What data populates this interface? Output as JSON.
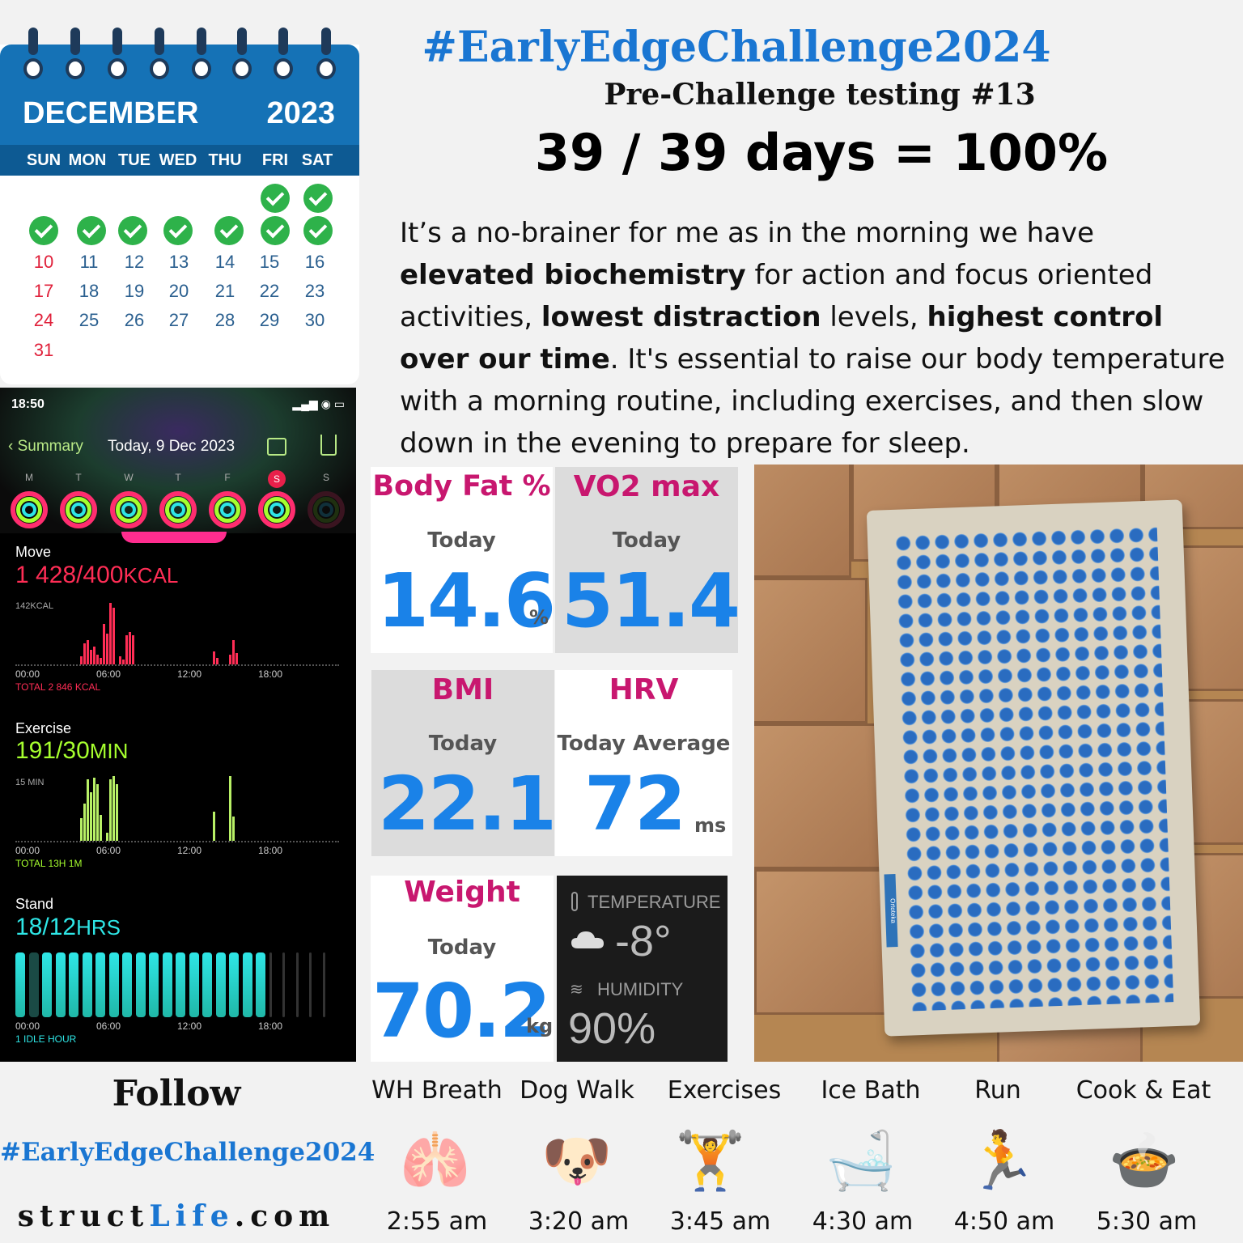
{
  "calendar": {
    "month": "DECEMBER",
    "year": "2023",
    "weekdays": [
      "SUN",
      "MON",
      "TUE",
      "WED",
      "THU",
      "FRI",
      "SAT"
    ],
    "rows": [
      [
        "10",
        "11",
        "12",
        "13",
        "14",
        "15",
        "16"
      ],
      [
        "17",
        "18",
        "19",
        "20",
        "21",
        "22",
        "23"
      ],
      [
        "24",
        "25",
        "26",
        "27",
        "28",
        "29",
        "30"
      ],
      [
        "31"
      ]
    ],
    "check_color": "#2eb24a"
  },
  "phone": {
    "time": "18:50",
    "back_label": "Summary",
    "date": "Today, 9 Dec 2023",
    "weekdays": [
      "M",
      "T",
      "W",
      "T",
      "F",
      "S",
      "S"
    ],
    "move": {
      "label": "Move",
      "value": "1 428/400",
      "unit": "KCAL",
      "scale": "142KCAL",
      "total": "TOTAL 2 846 KCAL",
      "color": "#ff2d55"
    },
    "exercise": {
      "label": "Exercise",
      "value": "191/30",
      "unit": "MIN",
      "scale": "15 MIN",
      "total": "TOTAL 13H 1M",
      "color": "#a6ff2e"
    },
    "stand": {
      "label": "Stand",
      "value": "18/12",
      "unit": "HRS",
      "total": "1 IDLE HOUR",
      "color": "#2ee6e6"
    },
    "axis": [
      "00:00",
      "06:00",
      "12:00",
      "18:00"
    ]
  },
  "header": {
    "hashtag": "#EarlyEdgeChallenge2024",
    "subtitle": "Pre-Challenge testing #13",
    "days": "39 / 39 days = 100%"
  },
  "paragraph": {
    "p1": "It’s a no-brainer for me as in the morning we have ",
    "b1": "elevated biochemistry",
    "p2": " for action and focus oriented activities, ",
    "b2": "lowest distraction",
    "p3": " levels, ",
    "b3": "highest control over our time",
    "p4": ". It's essential to raise our body temperature with a morning routine, including exercises, and then slow down in the evening to prepare for sleep."
  },
  "metrics": {
    "body_fat": {
      "label": "Body Fat %",
      "sub": "Today",
      "value": "14.6",
      "unit": "%"
    },
    "vo2": {
      "label": "VO2 max",
      "sub": "Today",
      "value": "51.4"
    },
    "bmi": {
      "label": "BMI",
      "sub": "Today",
      "value": "22.1"
    },
    "hrv": {
      "label": "HRV",
      "sub": "Today Average",
      "value": "72",
      "unit": "ms"
    },
    "weight": {
      "label": "Weight",
      "sub": "Today",
      "value": "70.2",
      "unit": "kg"
    }
  },
  "weather": {
    "temp_label": "TEMPERATURE",
    "temp": "-8°",
    "hum_label": "HUMIDITY",
    "humidity": "90%"
  },
  "photo": {
    "mat_brand": "Ortoteka"
  },
  "footer": {
    "follow": "Follow",
    "hashtag": "#EarlyEdgeChallenge2024",
    "site_a": "struct",
    "site_b": "Life",
    "site_c": ".com"
  },
  "activities": [
    {
      "name": "WH Breath",
      "time": "2:55 am",
      "icon": "lungs-icon"
    },
    {
      "name": "Dog Walk",
      "time": "3:20 am",
      "icon": "dog-icon"
    },
    {
      "name": "Exercises",
      "time": "3:45 am",
      "icon": "dumbbell-heart-icon"
    },
    {
      "name": "Ice Bath",
      "time": "4:30 am",
      "icon": "ice-bath-icon"
    },
    {
      "name": "Run",
      "time": "4:50 am",
      "icon": "runner-icon"
    },
    {
      "name": "Cook & Eat",
      "time": "5:30 am",
      "icon": "cooking-pot-icon"
    }
  ]
}
